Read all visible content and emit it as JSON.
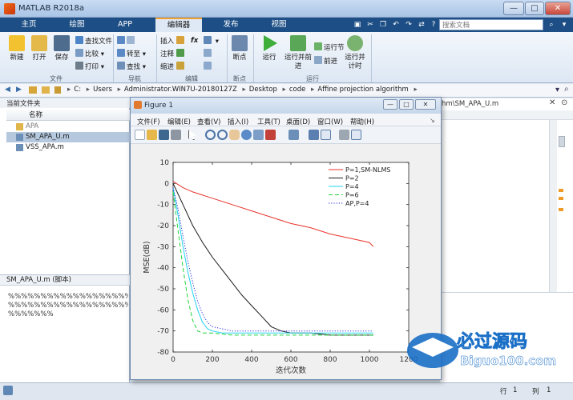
{
  "window": {
    "title": "MATLAB R2018a",
    "controls": [
      "—",
      "□",
      "✕"
    ]
  },
  "ribbon_tabs": [
    {
      "label": "主页",
      "active": false
    },
    {
      "label": "绘图",
      "active": false
    },
    {
      "label": "APP",
      "active": false
    },
    {
      "label": "编辑器",
      "active": true
    },
    {
      "label": "发布",
      "active": false
    },
    {
      "label": "视图",
      "active": false
    }
  ],
  "search": {
    "placeholder": "搜索文档"
  },
  "ribbon": {
    "file_group": {
      "label": "文件",
      "new": "新建",
      "open": "打开",
      "save": "保存",
      "find_files": "查找文件",
      "compare": "比较",
      "print": "打印"
    },
    "nav_group": {
      "label": "导航",
      "goto": "转至",
      "find": "查找"
    },
    "edit_group": {
      "label": "编辑",
      "insert": "插入",
      "comment": "注释",
      "indent": "缩进",
      "fx": "fx"
    },
    "breakpoint_group": {
      "label": "断点",
      "breakpoints": "断点"
    },
    "run_group": {
      "label": "运行",
      "run": "运行",
      "run_advance": "运行并前进",
      "run_section": "运行节",
      "advance": "前进",
      "run_time": "运行并计时"
    }
  },
  "address": {
    "crumbs": [
      "C:",
      "Users",
      "Administrator.WIN7U-20180127Z",
      "Desktop",
      "code",
      "Affine projection algorithm"
    ]
  },
  "left_panel": {
    "header": "当前文件夹",
    "column": "名称",
    "files": [
      {
        "name": "APA",
        "type": "folder",
        "selected": false
      },
      {
        "name": "SM_APA_U.m",
        "type": "file",
        "selected": true
      },
      {
        "name": "VSS_APA.m",
        "type": "file",
        "selected": false
      }
    ],
    "details_header": "SM_APA_U.m  (脚本)",
    "details_lines": [
      "%%%%%%%%%%%%%%%%%%%%%%%%",
      "%%%%%%%%%%%%%%%%%%%%%%%%",
      "%%%%%%%"
    ]
  },
  "editor": {
    "tab_path": "hm\\SM_APA_U.m"
  },
  "statusbar": {
    "row_label": "行",
    "row_value": "1",
    "col_label": "列",
    "col_value": "1"
  },
  "figure": {
    "title": "Figure 1",
    "menu": [
      "文件(F)",
      "编辑(E)",
      "查看(V)",
      "插入(I)",
      "工具(T)",
      "桌面(D)",
      "窗口(W)",
      "帮助(H)"
    ]
  },
  "watermark": {
    "text": "必过源码",
    "url": "Biguo100.com"
  },
  "colors": {
    "p1": "#e8342c",
    "p2": "#1a1a1a",
    "p4": "#22d3ee",
    "p6": "#1fd43a",
    "ap4": "#2a2ae0"
  },
  "chart_data": {
    "type": "line",
    "title": "",
    "xlabel": "迭代次数",
    "ylabel": "MSE(dB)",
    "xlim": [
      0,
      1200
    ],
    "ylim": [
      -80,
      10
    ],
    "xticks": [
      0,
      200,
      400,
      600,
      800,
      1000,
      1200
    ],
    "yticks": [
      10,
      0,
      -10,
      -20,
      -30,
      -40,
      -50,
      -60,
      -70,
      -80
    ],
    "legend_position": "top-right",
    "series": [
      {
        "name": "P=1,SM-NLMS",
        "style": "solid",
        "color": "#e8342c",
        "x": [
          0,
          50,
          100,
          200,
          300,
          400,
          500,
          600,
          700,
          800,
          900,
          1000,
          1020
        ],
        "y": [
          1,
          -2,
          -4,
          -7,
          -10,
          -13,
          -16,
          -19,
          -21,
          -24,
          -26,
          -28,
          -30
        ]
      },
      {
        "name": "P=2",
        "style": "solid",
        "color": "#1a1a1a",
        "x": [
          0,
          50,
          100,
          150,
          200,
          250,
          300,
          350,
          400,
          450,
          500,
          550,
          600,
          700,
          800,
          1020
        ],
        "y": [
          0,
          -10,
          -20,
          -28,
          -35,
          -41,
          -47,
          -53,
          -58,
          -63,
          -68,
          -70,
          -71,
          -71,
          -72,
          -72
        ]
      },
      {
        "name": "P=4",
        "style": "solid",
        "color": "#22d3ee",
        "x": [
          0,
          25,
          50,
          75,
          100,
          125,
          150,
          175,
          200,
          250,
          300,
          400,
          1020
        ],
        "y": [
          -2,
          -15,
          -30,
          -42,
          -52,
          -60,
          -66,
          -69,
          -70,
          -71,
          -71,
          -71,
          -71
        ]
      },
      {
        "name": "P=6",
        "style": "dash",
        "color": "#1fd43a",
        "x": [
          0,
          25,
          50,
          75,
          100,
          125,
          150,
          200,
          300,
          1020
        ],
        "y": [
          -4,
          -22,
          -40,
          -55,
          -65,
          -70,
          -71,
          -71,
          -72,
          -72
        ]
      },
      {
        "name": "AP,P=4",
        "style": "dot",
        "color": "#2a2ae0",
        "x": [
          0,
          25,
          50,
          75,
          100,
          125,
          150,
          175,
          200,
          250,
          300,
          400,
          1020
        ],
        "y": [
          -2,
          -12,
          -25,
          -37,
          -47,
          -56,
          -62,
          -66,
          -68,
          -69,
          -70,
          -70,
          -70
        ]
      }
    ]
  }
}
